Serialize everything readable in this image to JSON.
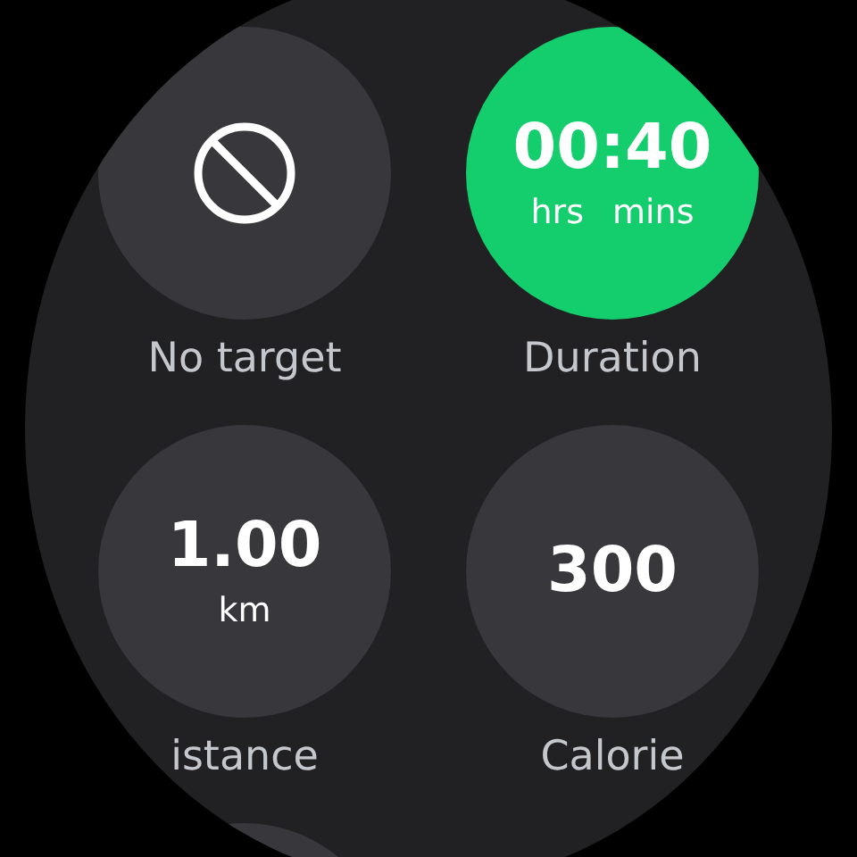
{
  "targets": [
    {
      "kind": "none",
      "label": "No target",
      "selected": false
    },
    {
      "kind": "time",
      "value": "00:40",
      "units": [
        "hrs",
        "mins"
      ],
      "label": "Duration",
      "selected": true
    },
    {
      "kind": "value",
      "value": "1.00",
      "units": [
        "km"
      ],
      "label": "istance",
      "selected": false
    },
    {
      "kind": "value",
      "value": "300",
      "label": "Calorie",
      "selected": false
    }
  ]
}
